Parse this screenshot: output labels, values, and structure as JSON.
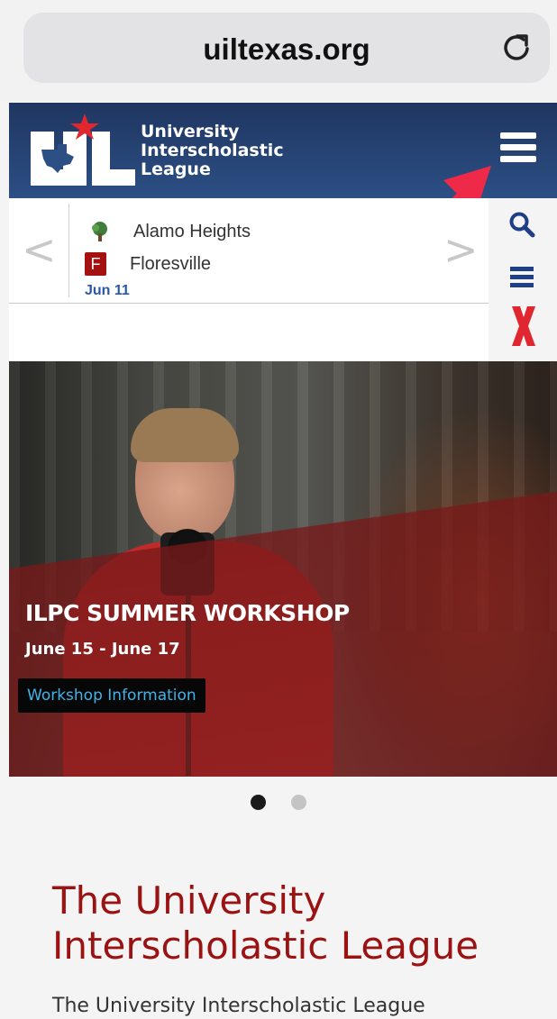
{
  "browser": {
    "url": "uiltexas.org"
  },
  "header": {
    "logo_lines": [
      "University",
      "Interscholastic",
      "League"
    ]
  },
  "scores": {
    "prev": "<",
    "next": ">",
    "team1": "Alamo Heights",
    "team2": "Floresville",
    "team2_badge": "F",
    "date": "Jun 11"
  },
  "hero": {
    "title": "ILPC SUMMER WORKSHOP",
    "date": "June 15 - June 17",
    "button": "Workshop Information"
  },
  "carousel": {
    "slides": 2,
    "active": 1
  },
  "about": {
    "title": "The University Interscholastic League",
    "body": "The University Interscholastic League"
  },
  "colors": {
    "header_bg": "#2c4f84",
    "accent_red": "#9b1212",
    "link_blue": "#2a58a8",
    "button_text": "#3fb3ea"
  },
  "icons": [
    "reload-icon",
    "hamburger-menu-icon",
    "search-icon",
    "menu-icon",
    "close-x-icon",
    "tree-logo-icon"
  ]
}
